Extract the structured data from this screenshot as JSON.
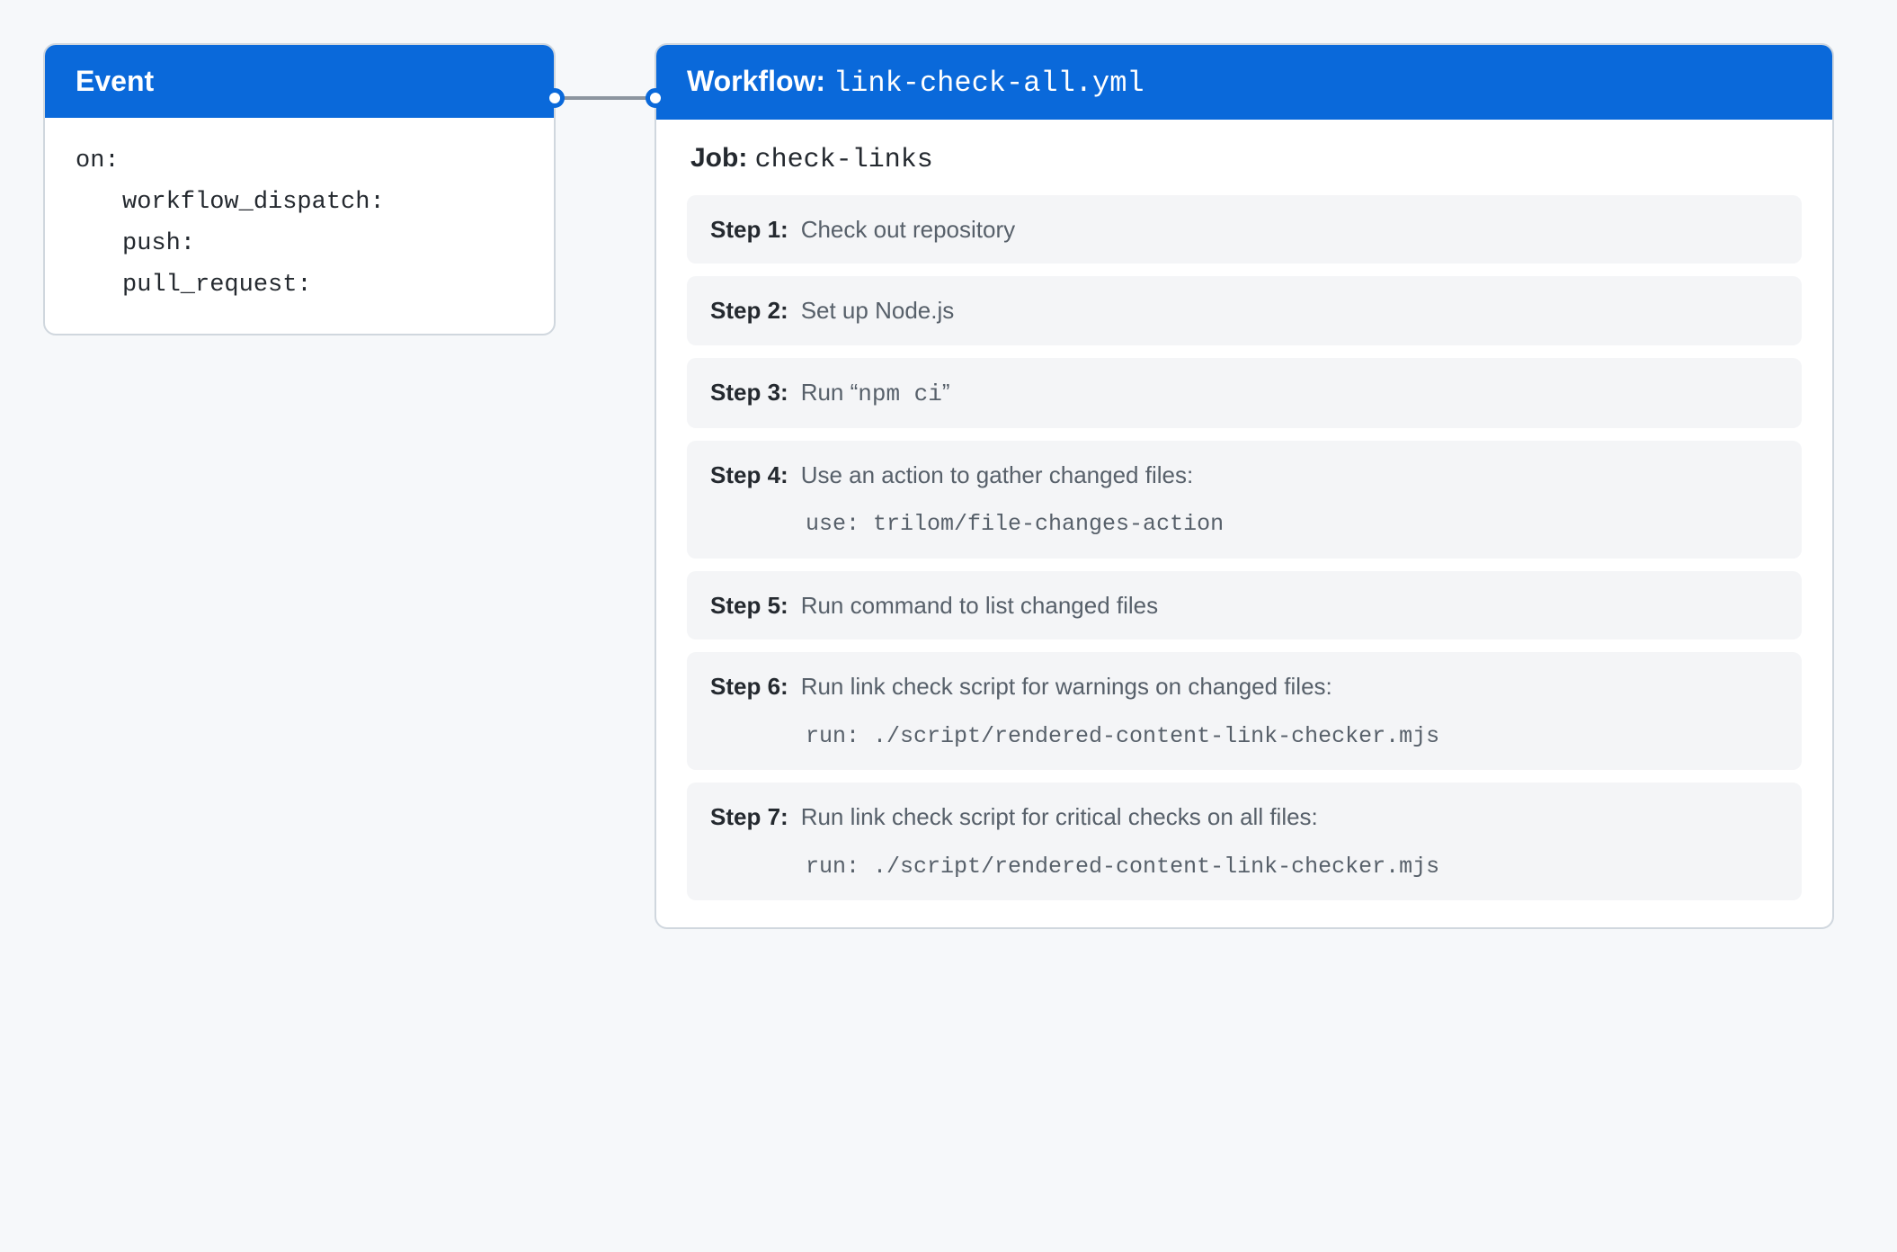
{
  "event": {
    "header": "Event",
    "on_label": "on:",
    "triggers": [
      "workflow_dispatch:",
      "push:",
      "pull_request:"
    ]
  },
  "workflow": {
    "header_label": "Workflow:",
    "header_file": "link-check-all.yml",
    "job_label": "Job:",
    "job_name": "check-links",
    "steps": [
      {
        "label": "Step 1:",
        "desc": "Check out repository"
      },
      {
        "label": "Step 2:",
        "desc": "Set up Node.js"
      },
      {
        "label": "Step 3:",
        "desc_prefix": "Run “",
        "desc_code": "npm ci",
        "desc_suffix": "”"
      },
      {
        "label": "Step 4:",
        "desc": "Use an action to gather changed files:",
        "code": "use: trilom/file-changes-action"
      },
      {
        "label": "Step 5:",
        "desc": "Run command to list changed files"
      },
      {
        "label": "Step 6:",
        "desc": "Run link check script for warnings on changed files:",
        "code": "run: ./script/rendered-content-link-checker.mjs"
      },
      {
        "label": "Step 7:",
        "desc": "Run link check script for critical checks on all files:",
        "code": "run: ./script/rendered-content-link-checker.mjs"
      }
    ]
  }
}
